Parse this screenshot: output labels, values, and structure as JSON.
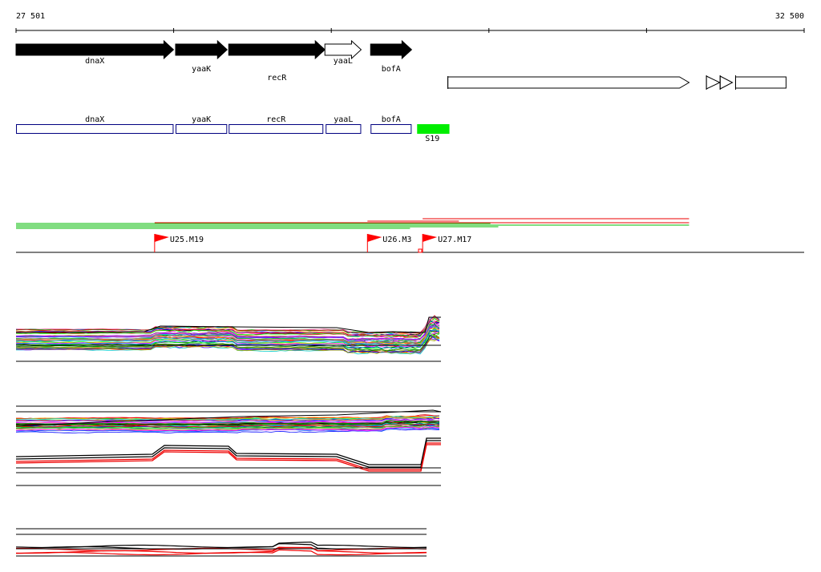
{
  "ruler": {
    "start_label": "27 501",
    "end_label": "32 500",
    "start": 27501,
    "end": 32500
  },
  "colors": {
    "line": "#000000",
    "annotation_outline": "#000080",
    "promoter": "#00ee00",
    "flag": "#ff0000",
    "red": "#ee0000",
    "green": "#00bb00"
  },
  "genes": [
    {
      "label": "dnaX",
      "start": 27501,
      "end": 28500,
      "style": "filled",
      "label_row": 1
    },
    {
      "label": "yaaK",
      "start": 28513,
      "end": 28840,
      "style": "filled",
      "label_row": 2
    },
    {
      "label": "recR",
      "start": 28850,
      "end": 29460,
      "style": "filled",
      "label_row": 3
    },
    {
      "label": "yaaL",
      "start": 29460,
      "end": 29690,
      "style": "open",
      "label_row": 1
    },
    {
      "label": "bofA",
      "start": 29750,
      "end": 30010,
      "style": "filled",
      "label_row": 2
    }
  ],
  "extra_features": [
    {
      "start": 30240,
      "end": 31770,
      "type": "arrow"
    },
    {
      "start": 31880,
      "end": 31965,
      "type": "triangle"
    },
    {
      "start": 31967,
      "end": 32045,
      "type": "triangle"
    },
    {
      "start": 32065,
      "end": 32385,
      "type": "box"
    }
  ],
  "annotations": [
    {
      "label": "dnaX",
      "start": 27501,
      "end": 28500
    },
    {
      "label": "yaaK",
      "start": 28513,
      "end": 28840
    },
    {
      "label": "recR",
      "start": 28850,
      "end": 29450
    },
    {
      "label": "yaaL",
      "start": 29465,
      "end": 29690
    },
    {
      "label": "bofA",
      "start": 29750,
      "end": 30010
    }
  ],
  "promoter": {
    "label": "S19",
    "start": 30045,
    "end": 30250
  },
  "flags": [
    {
      "label": "U25.M19",
      "pos": 28380
    },
    {
      "label": "U26.M3",
      "pos": 29730
    },
    {
      "label": "U27.M17",
      "pos": 30080
    }
  ],
  "transcripts": [
    {
      "start": 28380,
      "end": 31770,
      "color": "red"
    },
    {
      "start": 29730,
      "end": 30310,
      "color": "red"
    },
    {
      "start": 30080,
      "end": 31770,
      "color": "red"
    },
    {
      "start": 27501,
      "end": 30510,
      "color": "green"
    },
    {
      "start": 27501,
      "end": 31770,
      "color": "green"
    },
    {
      "start": 27501,
      "end": 30560,
      "color": "green"
    },
    {
      "start": 27501,
      "end": 30000,
      "color": "green"
    }
  ]
}
